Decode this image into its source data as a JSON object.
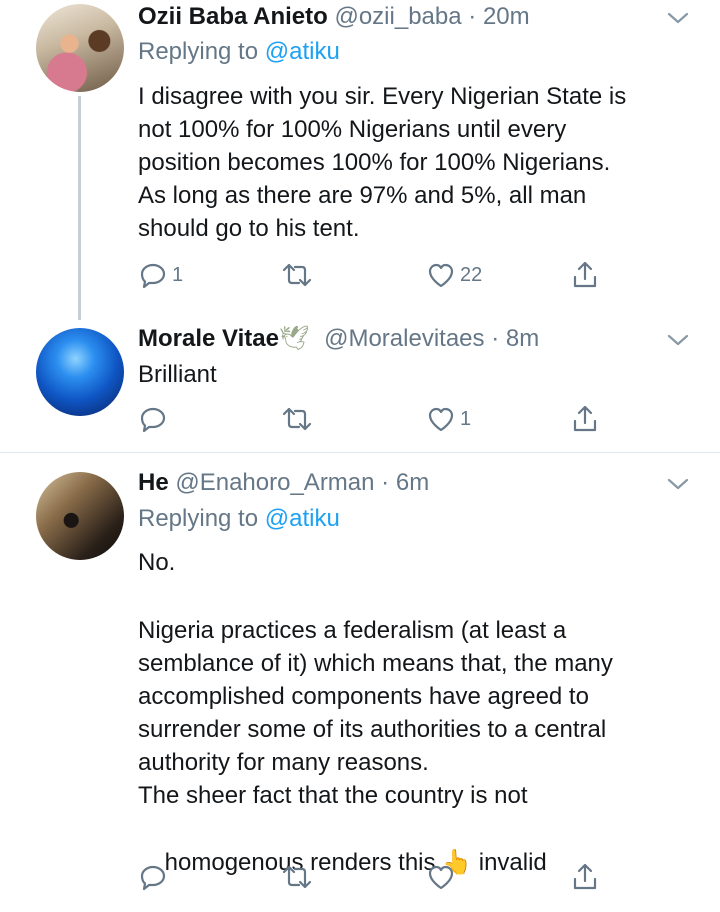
{
  "tweets": [
    {
      "name": "Ozii Baba Anieto",
      "handle": "@ozii_baba",
      "dot": "·",
      "time": "20m",
      "replying_label": "Replying to",
      "replying_to": "@atiku",
      "text": "I disagree with you sir. Every Nigerian State is\nnot 100% for 100% Nigerians until every\nposition becomes 100% for 100% Nigerians.\nAs long as there are 97% and 5%, all man\nshould go to his tent.",
      "reply_count": "1",
      "retweet_count": "",
      "like_count": "22"
    },
    {
      "name": "Morale Vitae",
      "name_emoji": "🕊",
      "handle": "@Moralevitaes",
      "dot": "·",
      "time": "8m",
      "text": "Brilliant",
      "reply_count": "",
      "retweet_count": "",
      "like_count": "1"
    },
    {
      "name": "He",
      "handle": "@Enahoro_Arman",
      "dot": "·",
      "time": "6m",
      "replying_label": "Replying to",
      "replying_to": "@atiku",
      "text_p1": "No.",
      "text_p2": "Nigeria practices a federalism (at least a\nsemblance of it) which means that, the many\naccomplished components have agreed to\nsurrender some of its authorities to a central\nauthority for many reasons.\nThe sheer fact that the country is not",
      "text_last_a": "homogenous renders this ",
      "text_emoji": "👆",
      "text_last_b": " invalid",
      "reply_count": "",
      "retweet_count": "",
      "like_count": ""
    }
  ],
  "icons": {
    "reply": "reply-icon",
    "retweet": "retweet-icon",
    "like": "heart-icon",
    "share": "share-icon",
    "more": "chevron-down-icon"
  },
  "colors": {
    "text": "#14171a",
    "secondary": "#657786",
    "link": "#1da1f2",
    "divider": "#e1e8ed",
    "thread_line": "#c4cfd6"
  }
}
